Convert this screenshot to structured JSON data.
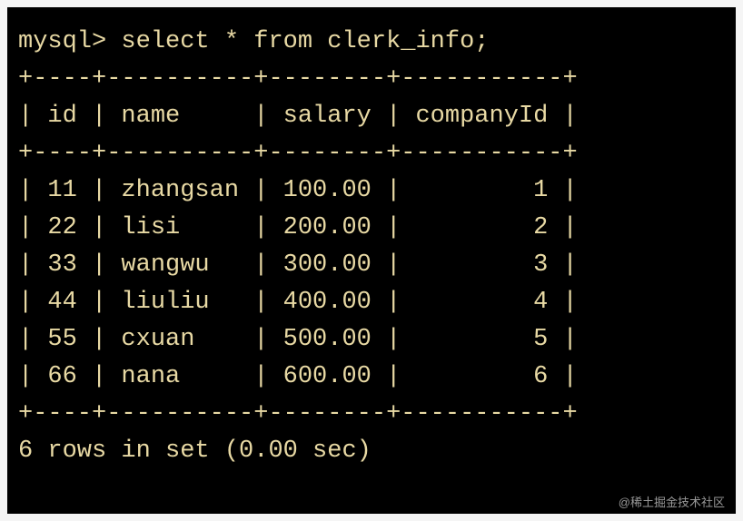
{
  "prompt": "mysql>",
  "query": "select * from clerk_info;",
  "separator": "+----+----------+--------+-----------+",
  "headers": {
    "id": "id",
    "name": "name",
    "salary": "salary",
    "companyId": "companyId"
  },
  "chart_data": {
    "type": "table",
    "columns": [
      "id",
      "name",
      "salary",
      "companyId"
    ],
    "rows": [
      {
        "id": 11,
        "name": "zhangsan",
        "salary": "100.00",
        "companyId": 1
      },
      {
        "id": 22,
        "name": "lisi",
        "salary": "200.00",
        "companyId": 2
      },
      {
        "id": 33,
        "name": "wangwu",
        "salary": "300.00",
        "companyId": 3
      },
      {
        "id": 44,
        "name": "liuliu",
        "salary": "400.00",
        "companyId": 4
      },
      {
        "id": 55,
        "name": "cxuan",
        "salary": "500.00",
        "companyId": 5
      },
      {
        "id": 66,
        "name": "nana",
        "salary": "600.00",
        "companyId": 6
      }
    ]
  },
  "footer": "6 rows in set (0.00 sec)",
  "watermark": "@稀土掘金技术社区"
}
